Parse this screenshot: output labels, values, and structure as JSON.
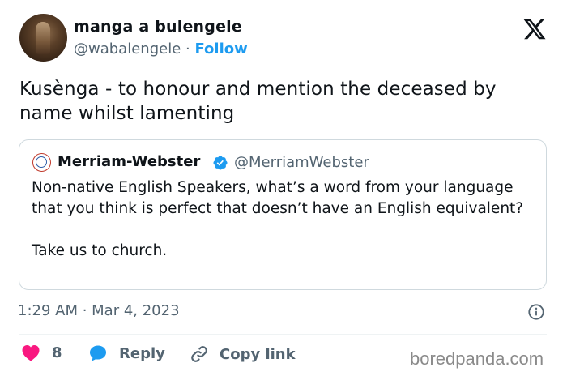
{
  "author": {
    "name": "manga a bulengele",
    "handle": "@wabalengele",
    "separator": "·",
    "follow_label": "Follow"
  },
  "tweet": {
    "text": "Kusènga - to honour and mention the deceased by name whilst lamenting"
  },
  "quoted_tweet": {
    "name": "Merriam-Webster",
    "handle": "@MerriamWebster",
    "text_line1": "Non-native English Speakers, what’s a word from your language that you think is perfect that doesn’t have an English equivalent?",
    "text_line2": "Take us to church."
  },
  "meta": {
    "timestamp": "1:29 AM · Mar 4, 2023"
  },
  "actions": {
    "like_count": "8",
    "reply_label": "Reply",
    "copy_label": "Copy link"
  },
  "watermark": {
    "text": "boredpanda.com"
  },
  "icons": {
    "brand": "x-logo-icon",
    "verified": "verified-badge-icon",
    "info": "info-icon",
    "like": "heart-icon",
    "reply": "speech-bubble-icon",
    "copy": "link-icon"
  },
  "colors": {
    "accent": "#1d9bf0",
    "like": "#f91880",
    "muted": "#536471",
    "text": "#0f1419"
  }
}
